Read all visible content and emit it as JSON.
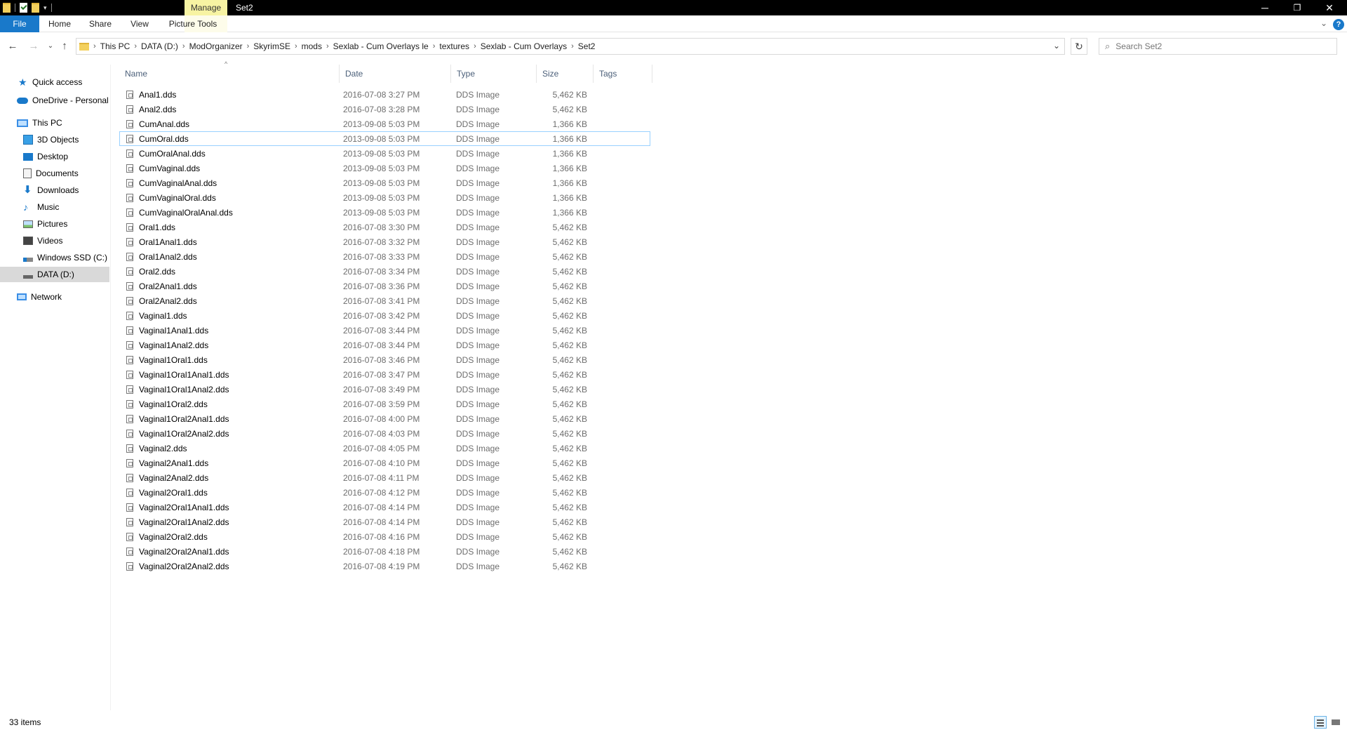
{
  "titlebar": {
    "context_tab": "Manage",
    "title": "Set2",
    "minimize": "─",
    "restore": "❐",
    "close": "✕"
  },
  "ribbon": {
    "tabs": [
      "File",
      "Home",
      "Share",
      "View",
      "Picture Tools"
    ]
  },
  "address": {
    "crumbs": [
      "This PC",
      "DATA (D:)",
      "ModOrganizer",
      "SkyrimSE",
      "mods",
      "Sexlab - Cum Overlays le",
      "textures",
      "Sexlab - Cum Overlays",
      "Set2"
    ]
  },
  "search": {
    "placeholder": "Search Set2"
  },
  "sidebar": {
    "items": [
      {
        "label": "Quick access",
        "icon": "star-icon"
      },
      {
        "label": "OneDrive - Personal",
        "icon": "cloud-icon"
      },
      {
        "label": "This PC",
        "icon": "computer-icon"
      },
      {
        "label": "3D Objects",
        "icon": "cube-icon"
      },
      {
        "label": "Desktop",
        "icon": "desktop-icon"
      },
      {
        "label": "Documents",
        "icon": "document-icon"
      },
      {
        "label": "Downloads",
        "icon": "download-icon"
      },
      {
        "label": "Music",
        "icon": "music-icon"
      },
      {
        "label": "Pictures",
        "icon": "picture-icon"
      },
      {
        "label": "Videos",
        "icon": "video-icon"
      },
      {
        "label": "Windows SSD (C:)",
        "icon": "drive-c-icon"
      },
      {
        "label": "DATA (D:)",
        "icon": "drive-d-icon"
      },
      {
        "label": "Network",
        "icon": "network-icon"
      }
    ]
  },
  "columns": {
    "name": "Name",
    "date": "Date",
    "type": "Type",
    "size": "Size",
    "tags": "Tags"
  },
  "files": [
    {
      "name": "Anal1.dds",
      "date": "2016-07-08 3:27 PM",
      "type": "DDS Image",
      "size": "5,462 KB"
    },
    {
      "name": "Anal2.dds",
      "date": "2016-07-08 3:28 PM",
      "type": "DDS Image",
      "size": "5,462 KB"
    },
    {
      "name": "CumAnal.dds",
      "date": "2013-09-08 5:03 PM",
      "type": "DDS Image",
      "size": "1,366 KB"
    },
    {
      "name": "CumOral.dds",
      "date": "2013-09-08 5:03 PM",
      "type": "DDS Image",
      "size": "1,366 KB"
    },
    {
      "name": "CumOralAnal.dds",
      "date": "2013-09-08 5:03 PM",
      "type": "DDS Image",
      "size": "1,366 KB"
    },
    {
      "name": "CumVaginal.dds",
      "date": "2013-09-08 5:03 PM",
      "type": "DDS Image",
      "size": "1,366 KB"
    },
    {
      "name": "CumVaginalAnal.dds",
      "date": "2013-09-08 5:03 PM",
      "type": "DDS Image",
      "size": "1,366 KB"
    },
    {
      "name": "CumVaginalOral.dds",
      "date": "2013-09-08 5:03 PM",
      "type": "DDS Image",
      "size": "1,366 KB"
    },
    {
      "name": "CumVaginalOralAnal.dds",
      "date": "2013-09-08 5:03 PM",
      "type": "DDS Image",
      "size": "1,366 KB"
    },
    {
      "name": "Oral1.dds",
      "date": "2016-07-08 3:30 PM",
      "type": "DDS Image",
      "size": "5,462 KB"
    },
    {
      "name": "Oral1Anal1.dds",
      "date": "2016-07-08 3:32 PM",
      "type": "DDS Image",
      "size": "5,462 KB"
    },
    {
      "name": "Oral1Anal2.dds",
      "date": "2016-07-08 3:33 PM",
      "type": "DDS Image",
      "size": "5,462 KB"
    },
    {
      "name": "Oral2.dds",
      "date": "2016-07-08 3:34 PM",
      "type": "DDS Image",
      "size": "5,462 KB"
    },
    {
      "name": "Oral2Anal1.dds",
      "date": "2016-07-08 3:36 PM",
      "type": "DDS Image",
      "size": "5,462 KB"
    },
    {
      "name": "Oral2Anal2.dds",
      "date": "2016-07-08 3:41 PM",
      "type": "DDS Image",
      "size": "5,462 KB"
    },
    {
      "name": "Vaginal1.dds",
      "date": "2016-07-08 3:42 PM",
      "type": "DDS Image",
      "size": "5,462 KB"
    },
    {
      "name": "Vaginal1Anal1.dds",
      "date": "2016-07-08 3:44 PM",
      "type": "DDS Image",
      "size": "5,462 KB"
    },
    {
      "name": "Vaginal1Anal2.dds",
      "date": "2016-07-08 3:44 PM",
      "type": "DDS Image",
      "size": "5,462 KB"
    },
    {
      "name": "Vaginal1Oral1.dds",
      "date": "2016-07-08 3:46 PM",
      "type": "DDS Image",
      "size": "5,462 KB"
    },
    {
      "name": "Vaginal1Oral1Anal1.dds",
      "date": "2016-07-08 3:47 PM",
      "type": "DDS Image",
      "size": "5,462 KB"
    },
    {
      "name": "Vaginal1Oral1Anal2.dds",
      "date": "2016-07-08 3:49 PM",
      "type": "DDS Image",
      "size": "5,462 KB"
    },
    {
      "name": "Vaginal1Oral2.dds",
      "date": "2016-07-08 3:59 PM",
      "type": "DDS Image",
      "size": "5,462 KB"
    },
    {
      "name": "Vaginal1Oral2Anal1.dds",
      "date": "2016-07-08 4:00 PM",
      "type": "DDS Image",
      "size": "5,462 KB"
    },
    {
      "name": "Vaginal1Oral2Anal2.dds",
      "date": "2016-07-08 4:03 PM",
      "type": "DDS Image",
      "size": "5,462 KB"
    },
    {
      "name": "Vaginal2.dds",
      "date": "2016-07-08 4:05 PM",
      "type": "DDS Image",
      "size": "5,462 KB"
    },
    {
      "name": "Vaginal2Anal1.dds",
      "date": "2016-07-08 4:10 PM",
      "type": "DDS Image",
      "size": "5,462 KB"
    },
    {
      "name": "Vaginal2Anal2.dds",
      "date": "2016-07-08 4:11 PM",
      "type": "DDS Image",
      "size": "5,462 KB"
    },
    {
      "name": "Vaginal2Oral1.dds",
      "date": "2016-07-08 4:12 PM",
      "type": "DDS Image",
      "size": "5,462 KB"
    },
    {
      "name": "Vaginal2Oral1Anal1.dds",
      "date": "2016-07-08 4:14 PM",
      "type": "DDS Image",
      "size": "5,462 KB"
    },
    {
      "name": "Vaginal2Oral1Anal2.dds",
      "date": "2016-07-08 4:14 PM",
      "type": "DDS Image",
      "size": "5,462 KB"
    },
    {
      "name": "Vaginal2Oral2.dds",
      "date": "2016-07-08 4:16 PM",
      "type": "DDS Image",
      "size": "5,462 KB"
    },
    {
      "name": "Vaginal2Oral2Anal1.dds",
      "date": "2016-07-08 4:18 PM",
      "type": "DDS Image",
      "size": "5,462 KB"
    },
    {
      "name": "Vaginal2Oral2Anal2.dds",
      "date": "2016-07-08 4:19 PM",
      "type": "DDS Image",
      "size": "5,462 KB"
    }
  ],
  "status": {
    "count": "33 items"
  },
  "colors": {
    "accent": "#1979ca",
    "context_tab": "#f7f3a3",
    "selection": "#d9d9d9",
    "focus_border": "#99d1ff"
  }
}
